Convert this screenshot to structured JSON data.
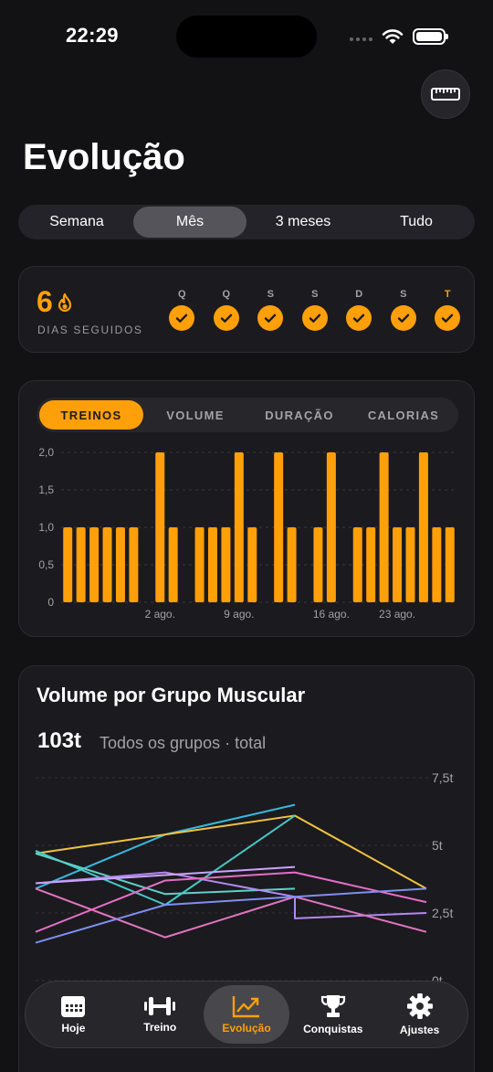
{
  "status": {
    "time": "22:29"
  },
  "header": {
    "title": "Evolução",
    "ruler_icon": "ruler-icon"
  },
  "periods": {
    "items": [
      "Semana",
      "Mês",
      "3 meses",
      "Tudo"
    ],
    "selected": "Mês"
  },
  "streak": {
    "count": "6",
    "label": "DIAS SEGUIDOS",
    "days": [
      {
        "letter": "Q",
        "done": true
      },
      {
        "letter": "Q",
        "done": true
      },
      {
        "letter": "S",
        "done": true
      },
      {
        "letter": "S",
        "done": true
      },
      {
        "letter": "D",
        "done": true
      },
      {
        "letter": "S",
        "done": true
      },
      {
        "letter": "T",
        "done": true,
        "today": true
      }
    ],
    "accent": "#ff9f0a"
  },
  "metric_tabs": {
    "items": [
      "TREINOS",
      "VOLUME",
      "DURAÇÃO",
      "CALORIAS"
    ],
    "selected": "TREINOS"
  },
  "chart_data": [
    {
      "type": "bar",
      "color": "#ff9f0a",
      "y_ticks": [
        "2,0",
        "1,5",
        "1,0",
        "0,5",
        "0"
      ],
      "ylim": [
        0,
        2
      ],
      "x_tick_labels": [
        "2 ago.",
        "9 ago.",
        "16 ago.",
        "23 ago."
      ],
      "values": [
        1,
        1,
        1,
        1,
        1,
        1,
        0,
        2,
        1,
        0,
        1,
        1,
        1,
        2,
        1,
        0,
        2,
        1,
        0,
        1,
        2,
        0,
        1,
        1,
        2,
        1,
        1,
        2,
        1,
        1
      ],
      "grid": true
    },
    {
      "type": "line",
      "title": "Volume por Grupo Muscular",
      "y_ticks": [
        "7,5t",
        "5t",
        "2,5t",
        "0t"
      ],
      "ylim": [
        0,
        7.5
      ],
      "series": [
        {
          "color": "#36b8e0",
          "values": [
            3.4,
            5.4,
            6.5
          ]
        },
        {
          "color": "#f0c341",
          "values": [
            4.7,
            5.4,
            6.1,
            3.4
          ]
        },
        {
          "color": "#46c8c6",
          "values": [
            4.8,
            2.8,
            6.1
          ]
        },
        {
          "color": "#5fd0c8",
          "values": [
            4.7,
            3.2,
            3.4
          ]
        },
        {
          "color": "#b388f0",
          "values": [
            3.6,
            4.0,
            3.1,
            2.3,
            2.5
          ]
        },
        {
          "color": "#c9a3ff",
          "values": [
            3.6,
            3.9,
            4.2
          ]
        },
        {
          "color": "#e46ec7",
          "values": [
            1.8,
            3.7,
            4.0,
            2.9
          ]
        },
        {
          "color": "#e075c0",
          "values": [
            3.4,
            1.6,
            3.1,
            1.8
          ]
        },
        {
          "color": "#7f8ff2",
          "values": [
            1.4,
            2.8,
            3.1,
            3.4
          ]
        }
      ]
    }
  ],
  "muscle_volume": {
    "title": "Volume por Grupo Muscular",
    "total": "103t",
    "subtitle": "Todos os grupos · total"
  },
  "tabbar": {
    "items": [
      {
        "label": "Hoje",
        "icon": "calendar-icon"
      },
      {
        "label": "Treino",
        "icon": "dumbbell-icon"
      },
      {
        "label": "Evolução",
        "icon": "chart-line-icon",
        "active": true
      },
      {
        "label": "Conquistas",
        "icon": "trophy-icon"
      },
      {
        "label": "Ajustes",
        "icon": "gear-icon"
      }
    ]
  }
}
